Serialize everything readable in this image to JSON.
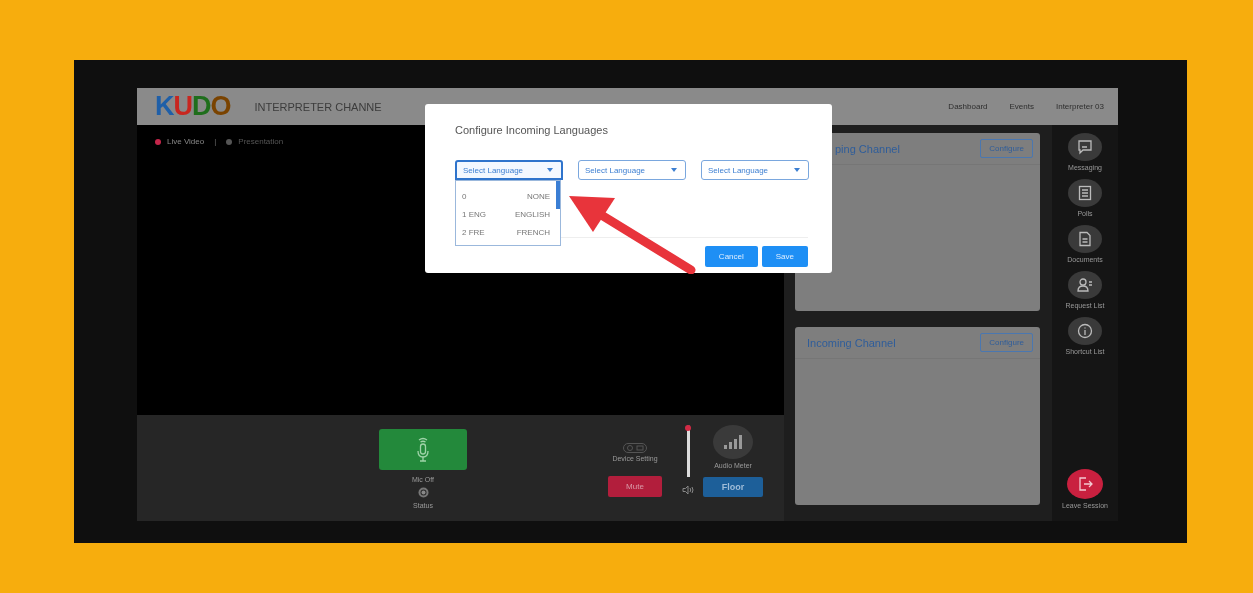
{
  "header": {
    "logo": "KUDO",
    "title": "INTERPRETER CHANNE",
    "nav": [
      {
        "label": "Dashboard"
      },
      {
        "label": "Events"
      },
      {
        "label": "Interpreter 03"
      }
    ]
  },
  "video": {
    "tabs": [
      {
        "label": "Live Video",
        "selected": true
      },
      {
        "label": "Presentation",
        "selected": false
      }
    ],
    "separator": "|"
  },
  "controls": {
    "mic_label": "Mic Off",
    "status_label": "Status",
    "device_label": "Device Setting",
    "mute": "Mute",
    "floor": "Floor",
    "volume": {
      "level": 0.95
    },
    "meter_label": "Audio Meter"
  },
  "channels": [
    {
      "title": "ping Channel",
      "button": "Configure"
    },
    {
      "title": "Incoming Channel",
      "button": "Configure"
    }
  ],
  "sidebar": [
    {
      "label": "Messaging",
      "kind": "chat"
    },
    {
      "label": "Polls",
      "kind": "list"
    },
    {
      "label": "Documents",
      "kind": "doc"
    },
    {
      "label": "Request List",
      "kind": "person"
    },
    {
      "label": "Shortcut List",
      "kind": "info"
    },
    {
      "label": "Leave Session",
      "kind": "leave"
    }
  ],
  "modal": {
    "title": "Configure Incoming Languages",
    "selects": [
      {
        "value": "Select Language",
        "expanded": true
      },
      {
        "value": "Select Language",
        "expanded": false
      },
      {
        "value": "Select Language",
        "expanded": false
      }
    ],
    "options": [
      {
        "code": "0",
        "name": "NONE"
      },
      {
        "code": "1 ENG",
        "name": "ENGLISH"
      },
      {
        "code": "2 FRE",
        "name": "FRENCH"
      }
    ],
    "buttons": [
      "Cancel",
      "Save"
    ]
  }
}
